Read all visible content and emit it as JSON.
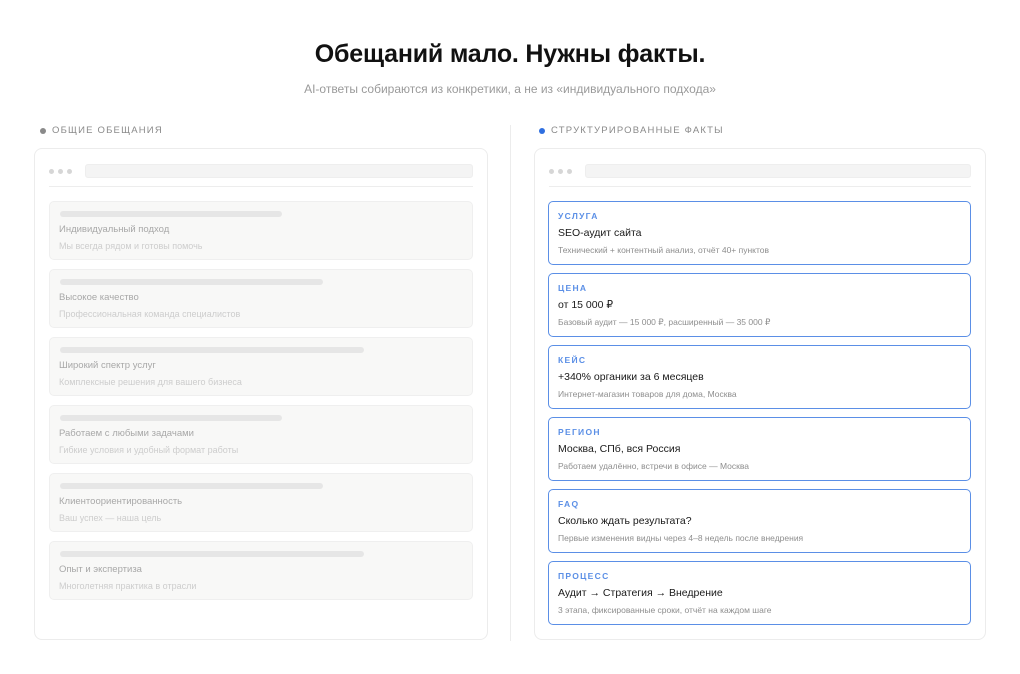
{
  "header": {
    "title": "Обещаний мало. Нужны факты.",
    "subtitle": "AI-ответы собираются из конкретики, а не из «индивидуального подхода»"
  },
  "left_column": {
    "label": "ОБЩИЕ ОБЕЩАНИЯ",
    "items": [
      {
        "title": "Индивидуальный подход",
        "desc": "Мы всегда рядом и готовы помочь"
      },
      {
        "title": "Высокое качество",
        "desc": "Профессиональная команда специалистов"
      },
      {
        "title": "Широкий спектр услуг",
        "desc": "Комплексные решения для вашего бизнеса"
      },
      {
        "title": "Работаем с любыми задачами",
        "desc": "Гибкие условия и удобный формат работы"
      },
      {
        "title": "Клиентоориентированность",
        "desc": "Ваш успех — наша цель"
      },
      {
        "title": "Опыт и экспертиза",
        "desc": "Многолетняя практика в отрасли"
      }
    ]
  },
  "right_column": {
    "label": "СТРУКТУРИРОВАННЫЕ ФАКТЫ",
    "items": [
      {
        "tag": "УСЛУГА",
        "title": "SEO-аудит сайта",
        "desc": "Технический + контентный анализ, отчёт 40+ пунктов"
      },
      {
        "tag": "ЦЕНА",
        "title": "от 15 000 ₽",
        "desc": "Базовый аудит — 15 000 ₽, расширенный — 35 000 ₽"
      },
      {
        "tag": "КЕЙС",
        "title": "+340% органики за 6 месяцев",
        "desc": "Интернет-магазин товаров для дома, Москва"
      },
      {
        "tag": "РЕГИОН",
        "title": "Москва, СПб, вся Россия",
        "desc": "Работаем удалённо, встречи в офисе — Москва"
      },
      {
        "tag": "FAQ",
        "title": "Сколько ждать результата?",
        "desc": "Первые изменения видны через 4–8 недель после внедрения"
      },
      {
        "tag": "ПРОЦЕСС",
        "title": "Аудит → Стратегия → Внедрение",
        "desc": "3 этапа, фиксированные сроки, отчёт на каждом шаге"
      }
    ]
  },
  "colors": {
    "accent": "#5b8fe6",
    "accent_dot": "#2f6fe0",
    "muted_dot": "#8a8a8a"
  }
}
